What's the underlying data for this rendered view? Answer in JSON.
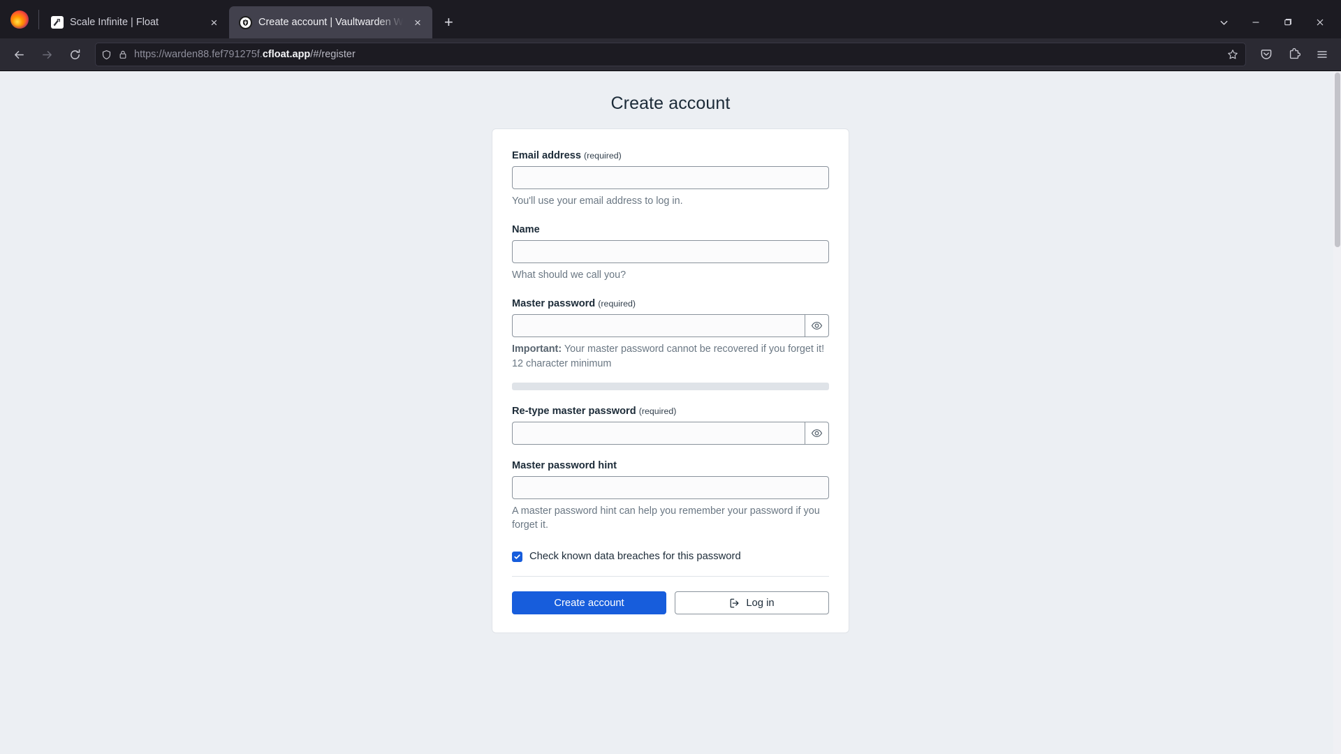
{
  "browser": {
    "tabs": [
      {
        "title": "Scale Infinite | Float",
        "favicon": "scale-infinite-icon",
        "active": false,
        "close_label": "×"
      },
      {
        "title": "Create account | Vaultwarden W",
        "favicon": "vaultwarden-icon",
        "active": true,
        "close_label": "×"
      }
    ],
    "new_tab_label": "+",
    "toolbar": {
      "back_label": "←",
      "forward_label": "→",
      "reload_label": "⟳",
      "shield_icon": "shield-icon",
      "lock_icon": "lock-icon",
      "url_scheme": "https://",
      "url_subdomain": "warden88.fef791275f.",
      "url_host": "cfloat.app",
      "url_path": "/#/register",
      "bookmark_icon": "star-icon",
      "pocket_icon": "pocket-icon",
      "extensions_icon": "extensions-icon",
      "menu_icon": "hamburger-menu-icon"
    },
    "window_controls": {
      "list_all_tabs": "chevron-down-icon",
      "minimize": "minimize-icon",
      "maximize": "maximize-icon",
      "close": "close-icon"
    }
  },
  "page": {
    "title": "Create account",
    "fields": {
      "email": {
        "label": "Email address",
        "required_text": "(required)",
        "value": "",
        "placeholder": "",
        "help": "You'll use your email address to log in."
      },
      "name": {
        "label": "Name",
        "required_text": "",
        "value": "",
        "placeholder": "",
        "help": "What should we call you?"
      },
      "master_password": {
        "label": "Master password",
        "required_text": "(required)",
        "value": "",
        "placeholder": "",
        "help_bold": "Important:",
        "help_rest": " Your master password cannot be recovered if you forget it! 12 character minimum",
        "toggle_icon": "eye-icon",
        "strength": 0
      },
      "retype_password": {
        "label": "Re-type master password",
        "required_text": "(required)",
        "value": "",
        "placeholder": "",
        "toggle_icon": "eye-icon"
      },
      "password_hint": {
        "label": "Master password hint",
        "required_text": "",
        "value": "",
        "placeholder": "",
        "help": "A master password hint can help you remember your password if you forget it."
      }
    },
    "checkbox": {
      "label": "Check known data breaches for this password",
      "checked": true
    },
    "buttons": {
      "primary": "Create account",
      "secondary": "Log in",
      "secondary_icon": "login-arrow-icon"
    },
    "colors": {
      "accent": "#175ddc",
      "page_bg": "#eceff3",
      "card_bg": "#ffffff",
      "border": "#dfe3e8",
      "text": "#1c2b38",
      "muted": "#6a7783"
    }
  }
}
